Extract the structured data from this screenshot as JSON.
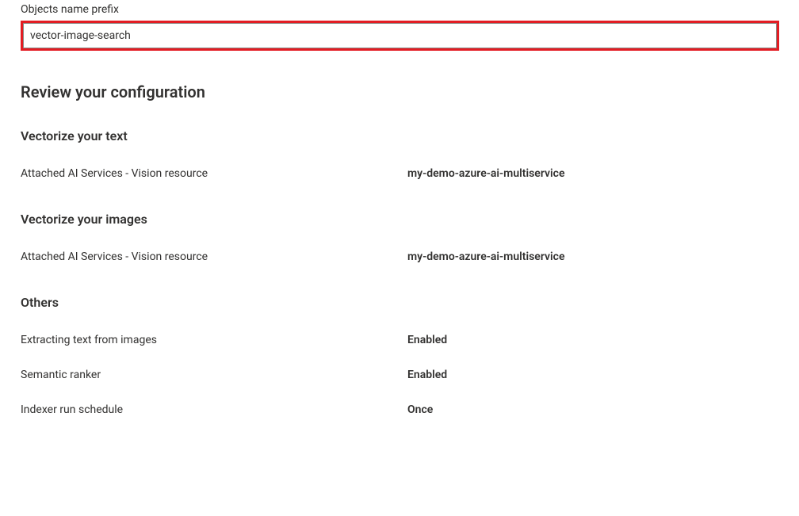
{
  "prefixField": {
    "label": "Objects name prefix",
    "value": "vector-image-search"
  },
  "review": {
    "heading": "Review your configuration",
    "sections": {
      "vectorizeText": {
        "heading": "Vectorize your text",
        "rows": [
          {
            "label": "Attached AI Services - Vision resource",
            "value": "my-demo-azure-ai-multiservice"
          }
        ]
      },
      "vectorizeImages": {
        "heading": "Vectorize your images",
        "rows": [
          {
            "label": "Attached AI Services - Vision resource",
            "value": "my-demo-azure-ai-multiservice"
          }
        ]
      },
      "others": {
        "heading": "Others",
        "rows": [
          {
            "label": "Extracting text from images",
            "value": "Enabled"
          },
          {
            "label": "Semantic ranker",
            "value": "Enabled"
          },
          {
            "label": "Indexer run schedule",
            "value": "Once"
          }
        ]
      }
    }
  }
}
